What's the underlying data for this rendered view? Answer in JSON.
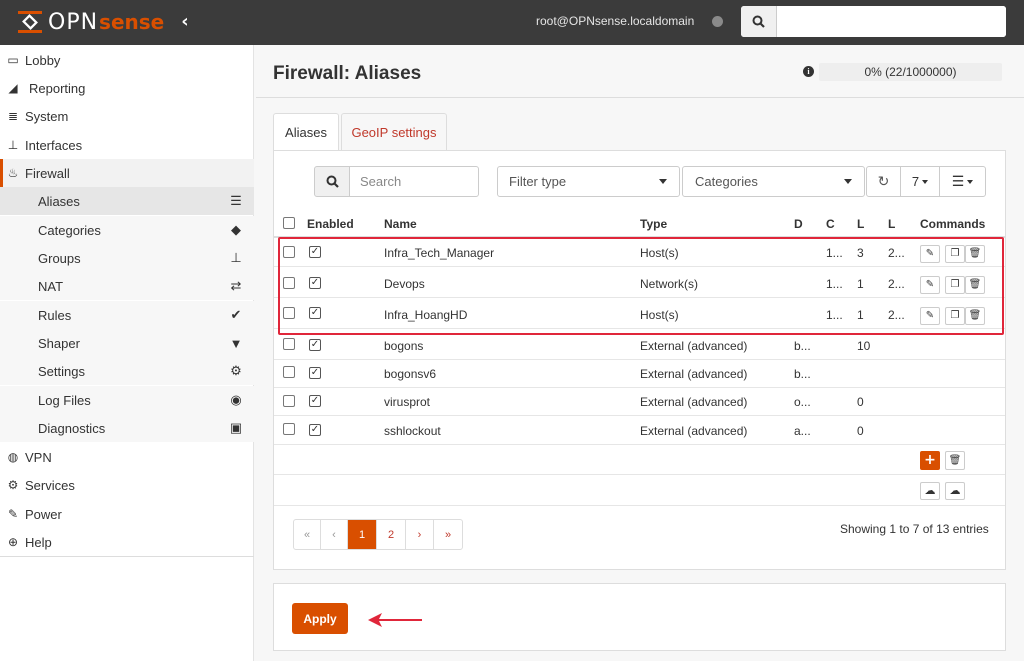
{
  "header": {
    "logo_text": "OPNsense",
    "user": "root@OPNsense.localdomain",
    "search_placeholder": ""
  },
  "sidebar": {
    "items": [
      {
        "label": "Lobby",
        "icon": "laptop-icon"
      },
      {
        "label": "Reporting",
        "icon": "area-chart-icon"
      },
      {
        "label": "System",
        "icon": "server-icon"
      },
      {
        "label": "Interfaces",
        "icon": "sitemap-icon"
      },
      {
        "label": "Firewall",
        "icon": "fire-icon"
      },
      {
        "label": "VPN",
        "icon": "globe-icon"
      },
      {
        "label": "Services",
        "icon": "cog-icon"
      },
      {
        "label": "Power",
        "icon": "plug-icon"
      },
      {
        "label": "Help",
        "icon": "life-ring-icon"
      }
    ],
    "firewall_sub": [
      {
        "label": "Aliases",
        "icon": "list-alt-icon"
      },
      {
        "label": "Categories",
        "icon": "tags-icon"
      },
      {
        "label": "Groups",
        "icon": "sitemap-icon"
      },
      {
        "label": "NAT",
        "icon": "exchange-icon"
      },
      {
        "label": "Rules",
        "icon": "check-icon"
      },
      {
        "label": "Shaper",
        "icon": "filter-icon"
      },
      {
        "label": "Settings",
        "icon": "cogs-icon"
      },
      {
        "label": "Log Files",
        "icon": "eye-icon"
      },
      {
        "label": "Diagnostics",
        "icon": "medkit-icon"
      }
    ]
  },
  "main": {
    "title": "Firewall: Aliases",
    "progress_text": "0% (22/1000000)",
    "progress_fraction": 2.2e-05,
    "tabs": [
      {
        "label": "Aliases"
      },
      {
        "label": "GeoIP settings"
      }
    ],
    "search_placeholder": "Search",
    "filter_type": "Filter type",
    "categories": "Categories",
    "rows_per_page": "7",
    "columns": [
      "Enabled",
      "Name",
      "Type",
      "D",
      "C",
      "L",
      "L",
      "Commands"
    ],
    "rows": [
      {
        "name": "Infra_Tech_Manager",
        "type": "Host(s)",
        "d": "",
        "c": "1...",
        "l1": "3",
        "l2": "2..."
      },
      {
        "name": "Devops",
        "type": "Network(s)",
        "d": "",
        "c": "1...",
        "l1": "1",
        "l2": "2..."
      },
      {
        "name": "Infra_HoangHD",
        "type": "Host(s)",
        "d": "",
        "c": "1...",
        "l1": "1",
        "l2": "2..."
      },
      {
        "name": "bogons",
        "type": "External (advanced)",
        "d": "b...",
        "c": "",
        "l1": "10",
        "l2": ""
      },
      {
        "name": "bogonsv6",
        "type": "External (advanced)",
        "d": "b...",
        "c": "",
        "l1": "",
        "l2": ""
      },
      {
        "name": "virusprot",
        "type": "External (advanced)",
        "d": "o...",
        "c": "",
        "l1": "0",
        "l2": ""
      },
      {
        "name": "sshlockout",
        "type": "External (advanced)",
        "d": "a...",
        "c": "",
        "l1": "0",
        "l2": ""
      }
    ],
    "pagination": [
      "«",
      "‹",
      "1",
      "2",
      "›",
      "»"
    ],
    "showing": "Showing 1 to 7 of 13 entries",
    "apply_label": "Apply"
  },
  "colors": {
    "accent": "#d94f00",
    "topbar": "#3b3b3b",
    "highlight": "#e0263a"
  }
}
